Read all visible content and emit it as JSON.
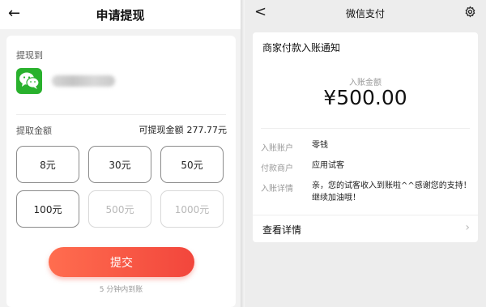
{
  "left": {
    "header": {
      "back_icon": "←",
      "title": "申请提现"
    },
    "withdraw_to_label": "提现到",
    "account_icon": "wechat-logo-icon",
    "amount_label": "提取金额",
    "available_label": "可提现金额",
    "available_value": "277.77元",
    "amounts": [
      {
        "label": "8元",
        "enabled": true
      },
      {
        "label": "30元",
        "enabled": true
      },
      {
        "label": "50元",
        "enabled": true
      },
      {
        "label": "100元",
        "enabled": true
      },
      {
        "label": "500元",
        "enabled": false
      },
      {
        "label": "1000元",
        "enabled": false
      }
    ],
    "submit_label": "提交",
    "arrival_note": "5 分钟内到账",
    "colors": {
      "submit_start": "#ff6d4f",
      "submit_end": "#f2463c",
      "wechat_green": "#29b12d"
    }
  },
  "right": {
    "header": {
      "back_icon": "<",
      "title": "微信支付",
      "settings_icon": "gear-icon"
    },
    "notice_title": "商家付款入账通知",
    "amount_caption": "入账金额",
    "amount_value": "¥500.00",
    "rows": [
      {
        "label": "入账账户",
        "value": "零钱"
      },
      {
        "label": "付款商户",
        "value": "应用试客"
      },
      {
        "label": "入账详情",
        "value": "亲，您的试客收入到账啦^^感谢您的支持！继续加油哦！"
      }
    ],
    "detail_link": "查看详情",
    "detail_chevron": "›"
  }
}
